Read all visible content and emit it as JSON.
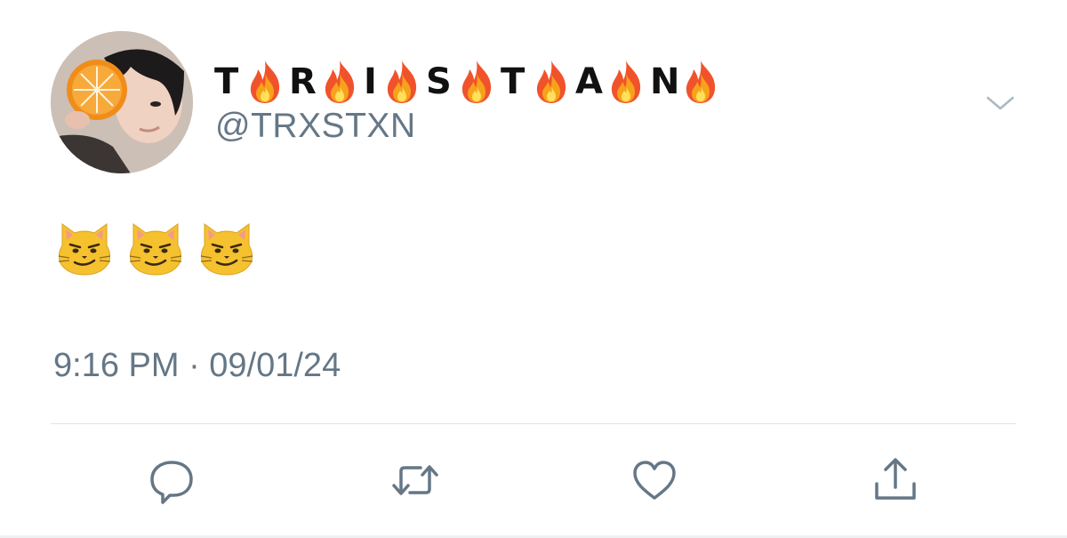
{
  "tweet": {
    "display_name_letters": [
      "T",
      "R",
      "I",
      "S",
      "T",
      "A",
      "N"
    ],
    "display_name_separator_icon": "fire-emoji",
    "handle": "@TRXSTXN",
    "body_emojis": [
      "smirking-cat-emoji",
      "smirking-cat-emoji",
      "smirking-cat-emoji"
    ],
    "timestamp": "9:16 PM · 09/01/24"
  },
  "icons": {
    "menu": "chevron-down-icon",
    "reply": "reply-icon",
    "retweet": "retweet-icon",
    "like": "heart-icon",
    "share": "share-icon"
  },
  "colors": {
    "secondary_text": "#657786",
    "icon": "#657786",
    "chevron": "#aab8c2",
    "divider": "#dfe4e8",
    "name_text": "#111111"
  }
}
